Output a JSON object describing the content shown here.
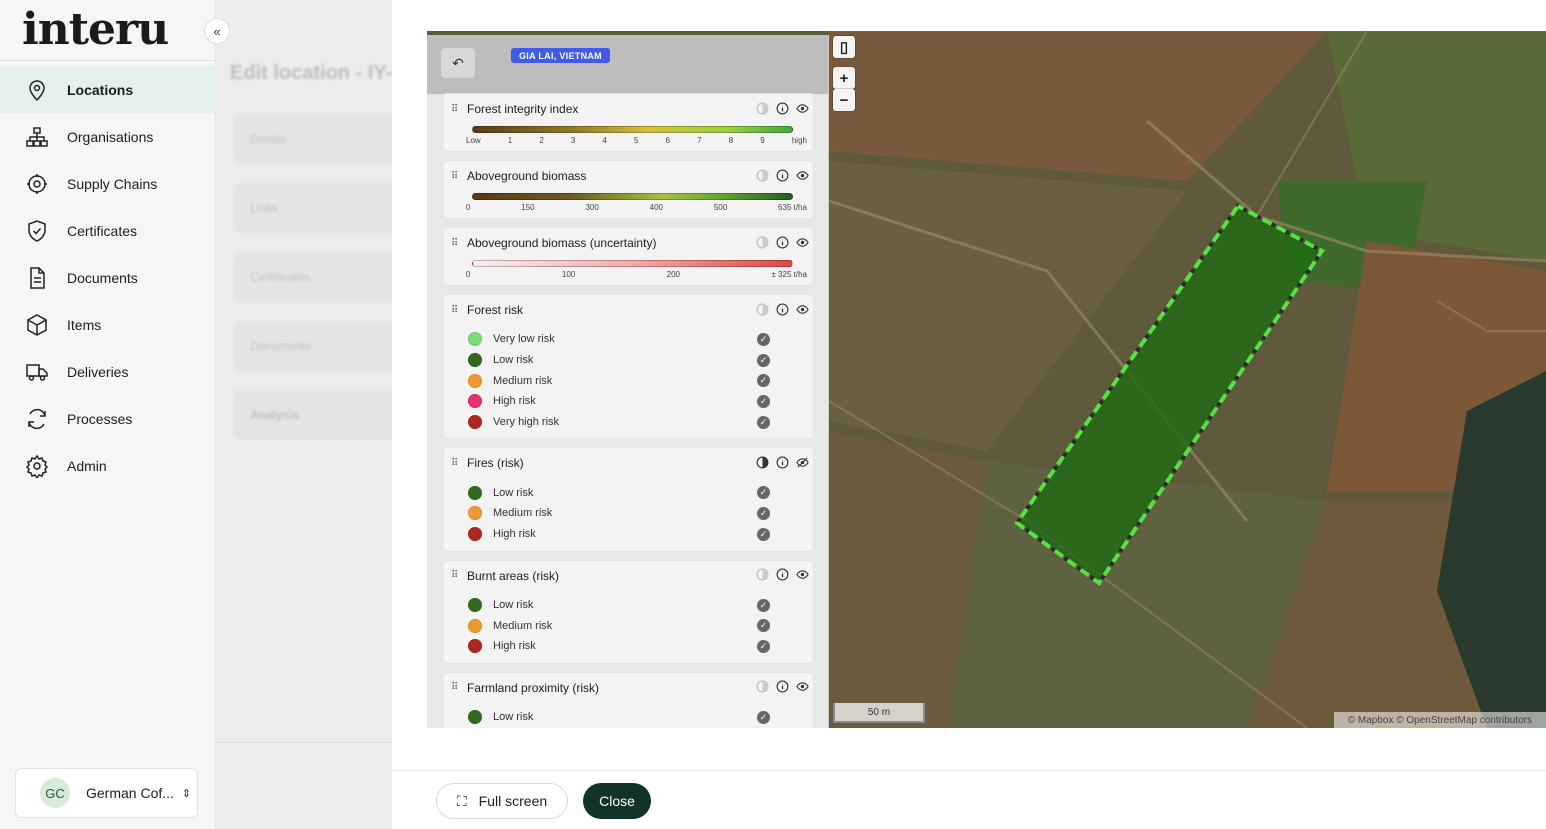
{
  "sidebar": {
    "logo": "interu",
    "collapse_icon": "«",
    "items": [
      {
        "label": "Locations",
        "icon": "map-pin-icon",
        "active": true
      },
      {
        "label": "Organisations",
        "icon": "org-chart-icon"
      },
      {
        "label": "Supply Chains",
        "icon": "supply-chain-icon"
      },
      {
        "label": "Certificates",
        "icon": "shield-check-icon"
      },
      {
        "label": "Documents",
        "icon": "document-icon"
      },
      {
        "label": "Items",
        "icon": "cube-icon"
      },
      {
        "label": "Deliveries",
        "icon": "truck-icon"
      },
      {
        "label": "Processes",
        "icon": "refresh-icon"
      },
      {
        "label": "Admin",
        "icon": "gear-icon"
      }
    ],
    "org": {
      "initials": "GC",
      "name": "German Cof...",
      "chevron": "⌃⌄"
    }
  },
  "background_page": {
    "title": "Edit location - IY-",
    "tabs": [
      "Details",
      "Links",
      "Certificates",
      "Documents",
      "Analysis"
    ]
  },
  "map": {
    "location_badge": "GIA LAI, VIETNAM",
    "zoom_in": "+",
    "zoom_out": "−",
    "scale": "50 m",
    "attribution": "© Mapbox © OpenStreetMap contributors",
    "colors": {
      "plot_fill": "#1f6a12",
      "plot_stroke": "#58e046"
    }
  },
  "layers": [
    {
      "title": "Forest integrity index",
      "type": "gradient",
      "gradient": "linear-gradient(to right, #5b3b1b, #8b7a22 30%, #d3c23a 55%, #9bd040 80%, #3fa83a)",
      "labels": [
        "Low",
        "1",
        "2",
        "3",
        "4",
        "5",
        "6",
        "7",
        "8",
        "9",
        "high"
      ],
      "eye": "visible"
    },
    {
      "title": "Aboveground biomass",
      "type": "gradient",
      "gradient": "linear-gradient(to right, #5a3a1a, #6b5a20 30%, #a7c23a 60%, #5aa02f 80%, #255e1c)",
      "labels": [
        "0",
        "150",
        "300",
        "400",
        "500",
        "635 t/ha"
      ],
      "eye": "visible"
    },
    {
      "title": "Aboveground biomass (uncertainty)",
      "type": "gradient",
      "gradient": "linear-gradient(to right, #fbeeee, #f4aaaa 50%, #e2473f)",
      "labels": [
        "0",
        "100",
        "200",
        "± 325 t/ha"
      ],
      "eye": "visible"
    },
    {
      "title": "Forest risk",
      "type": "legend",
      "eye": "visible",
      "entries": [
        {
          "label": "Very low risk",
          "color": "#7fda7a"
        },
        {
          "label": "Low risk",
          "color": "#2f6a1e"
        },
        {
          "label": "Medium risk",
          "color": "#ef9a2f"
        },
        {
          "label": "High risk",
          "color": "#e8336a"
        },
        {
          "label": "Very high risk",
          "color": "#b2271c"
        }
      ]
    },
    {
      "title": "Fires (risk)",
      "type": "legend",
      "eye": "hidden",
      "entries": [
        {
          "label": "Low risk",
          "color": "#2f6a1e"
        },
        {
          "label": "Medium risk",
          "color": "#ef9a2f"
        },
        {
          "label": "High risk",
          "color": "#b2271c"
        }
      ]
    },
    {
      "title": "Burnt areas (risk)",
      "type": "legend",
      "eye": "visible",
      "entries": [
        {
          "label": "Low risk",
          "color": "#2f6a1e"
        },
        {
          "label": "Medium risk",
          "color": "#ef9a2f"
        },
        {
          "label": "High risk",
          "color": "#b2271c"
        }
      ]
    },
    {
      "title": "Farmland proximity (risk)",
      "type": "legend",
      "eye": "visible",
      "entries": [
        {
          "label": "Low risk",
          "color": "#2f6a1e"
        }
      ]
    }
  ],
  "footer": {
    "full_screen_label": "Full screen",
    "close_label": "Close"
  }
}
